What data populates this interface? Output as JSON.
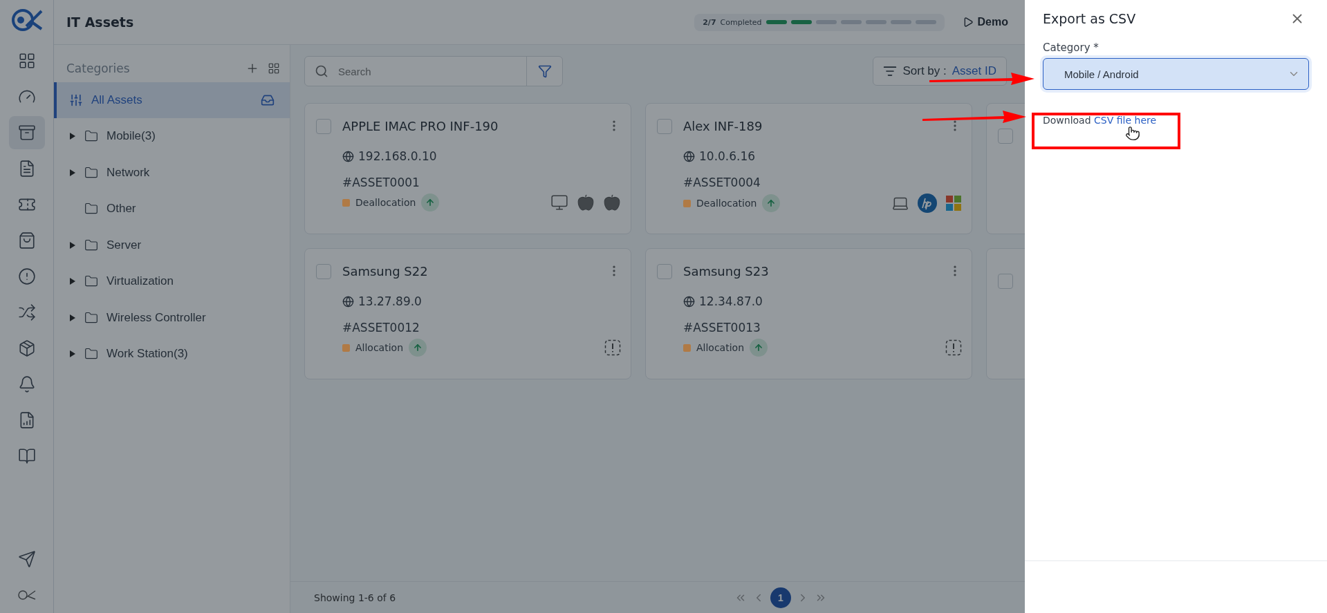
{
  "header": {
    "title": "IT Assets",
    "progress": {
      "count": "2/7",
      "label": "Completed",
      "steps": [
        {
          "done": true
        },
        {
          "done": true
        },
        {
          "done": false
        },
        {
          "done": false
        },
        {
          "done": false
        },
        {
          "done": false
        },
        {
          "done": false
        }
      ]
    },
    "demo": "Demo"
  },
  "rail": [
    {
      "kind": "grid-plus",
      "selected": false
    },
    {
      "kind": "gauge",
      "selected": false
    },
    {
      "kind": "archive",
      "selected": true
    },
    {
      "kind": "file",
      "selected": false
    },
    {
      "kind": "ticket",
      "selected": false
    },
    {
      "kind": "bag",
      "selected": false
    },
    {
      "kind": "alert",
      "selected": false
    },
    {
      "kind": "shuffle",
      "selected": false
    },
    {
      "kind": "package",
      "selected": false
    },
    {
      "kind": "bell",
      "selected": false
    },
    {
      "kind": "report",
      "selected": false
    },
    {
      "kind": "book",
      "selected": false
    }
  ],
  "categories": {
    "title": "Categories",
    "all": {
      "label": "All Assets",
      "selected": true
    },
    "items": [
      {
        "label": "Mobile(3)",
        "expandable": true
      },
      {
        "label": "Network",
        "expandable": true
      },
      {
        "label": "Other",
        "expandable": false
      },
      {
        "label": "Server",
        "expandable": true
      },
      {
        "label": "Virtualization",
        "expandable": true
      },
      {
        "label": "Wireless Controller",
        "expandable": true
      },
      {
        "label": "Work Station(3)",
        "expandable": true
      }
    ]
  },
  "toolbar": {
    "search": {
      "placeholder": "Search"
    },
    "sort_label": "Sort by :",
    "sort_value": "Asset ID"
  },
  "cards": [
    {
      "kind": "full",
      "checked": false,
      "title": "APPLE IMAC PRO INF-190",
      "ip": "192.168.0.10",
      "asset": "#ASSET0001",
      "status": "Deallocation",
      "color": "#b07a45",
      "icons": [
        {
          "kind": "monitor"
        },
        {
          "kind": "apple"
        },
        {
          "kind": "apple"
        }
      ]
    },
    {
      "kind": "full",
      "checked": false,
      "title": "Alex INF-189",
      "ip": "10.0.6.16",
      "asset": "#ASSET0004",
      "status": "Deallocation",
      "color": "#b07a45",
      "icons": [
        {
          "kind": "laptop"
        },
        {
          "kind": "hp"
        },
        {
          "kind": "windows"
        }
      ]
    },
    {
      "kind": "partial",
      "checked": false
    },
    {
      "kind": "full",
      "checked": false,
      "title": "Samsung S22",
      "ip": "13.27.89.0",
      "asset": "#ASSET0012",
      "status": "Allocation",
      "color": "#b07a45",
      "icons": [
        {
          "kind": "alert"
        }
      ]
    },
    {
      "kind": "full",
      "checked": false,
      "title": "Samsung S23",
      "ip": "12.34.87.0",
      "asset": "#ASSET0013",
      "status": "Allocation",
      "color": "#b07a45",
      "icons": [
        {
          "kind": "alert"
        }
      ]
    },
    {
      "kind": "partial",
      "checked": false
    }
  ],
  "footer": {
    "showing": "Showing 1-6 of 6",
    "pages": [
      {
        "label": "1",
        "selected": true
      }
    ]
  },
  "drawer": {
    "title": "Export as CSV",
    "field_label": "Category *",
    "value": "Mobile / Android",
    "download_text": "Download",
    "download_link": "CSV file here"
  }
}
